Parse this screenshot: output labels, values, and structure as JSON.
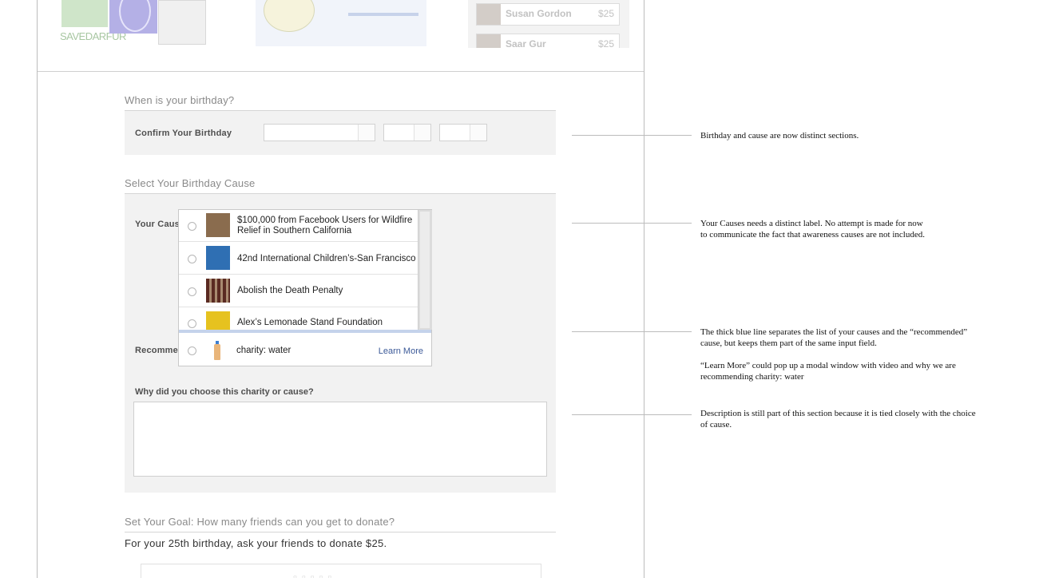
{
  "top_strip": {
    "logo_text": "SAVEDARFUR",
    "donors": [
      {
        "name": "Susan Gordon",
        "amount": "$25"
      },
      {
        "name": "Saar Gur",
        "amount": "$25"
      }
    ]
  },
  "birthday": {
    "section_title": "When is your birthday?",
    "confirm_label": "Confirm Your Birthday",
    "month_value": "",
    "day_value": "",
    "year_value": ""
  },
  "cause": {
    "section_title": "Select Your Birthday Cause",
    "your_causes_label": "Your Causes",
    "items": [
      {
        "title": "$100,000 from Facebook Users for Wildfire Relief in Southern California",
        "thumb": "wildfire-photo",
        "color": "#8a6c4e"
      },
      {
        "title": "42nd International Children’s-San Francisco",
        "thumb": "children-photo",
        "color": "#2f6fb3"
      },
      {
        "title": "Abolish the Death Penalty",
        "thumb": "prison-bars-photo",
        "color": "#5a2a22"
      },
      {
        "title": "Alex’s Lemonade Stand Foundation",
        "thumb": "lemonade-logo",
        "color": "#e6c21f"
      }
    ],
    "recommended_label": "Recommended Cause",
    "recommended_name": "charity: water",
    "learn_more": "Learn More",
    "why_label": "Why did you choose this charity or cause?",
    "why_value": ""
  },
  "goal": {
    "section_title": "Set Your Goal: How many friends can you get to donate?",
    "text": "For your 25th birthday, ask your friends to donate $25.",
    "dots": "○○○○○"
  },
  "annotations": [
    {
      "lines": [
        "Birthday and cause are now distinct sections."
      ]
    },
    {
      "lines": [
        "Your Causes needs a distinct label. No attempt is made for now",
        "to communicate the fact that awareness causes are not included."
      ]
    },
    {
      "lines": [
        "The thick blue line separates the list of your causes and the “recommended”",
        "cause, but keeps them part of the same input field."
      ]
    },
    {
      "lines": [
        "“Learn More” could pop up a modal window with video and why we are",
        "recommending charity: water"
      ]
    },
    {
      "lines": [
        "Description is still part of this section because it is tied closely with the choice",
        "of cause."
      ]
    }
  ],
  "colors": {
    "separator_blue": "#c5d3eb",
    "link_blue": "#3b5998",
    "panel_gray": "#f2f2f2"
  }
}
